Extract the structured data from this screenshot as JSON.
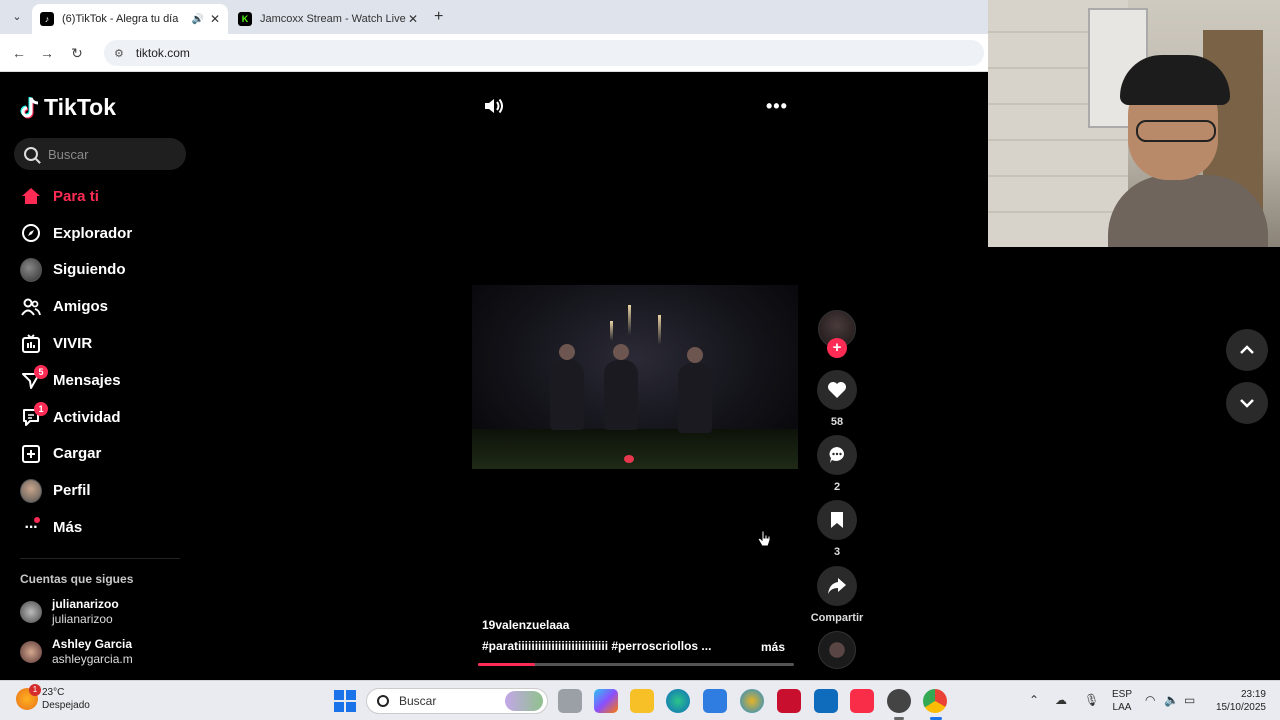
{
  "browser": {
    "tabs": [
      {
        "title": "(6)TikTok - Alegra tu día",
        "active": true,
        "favicon": "tiktok-favicon"
      },
      {
        "title": "Jamcoxx Stream - Watch Live on",
        "active": false,
        "favicon": "kick-favicon"
      }
    ],
    "url": "tiktok.com"
  },
  "sidebar": {
    "logo": "TikTok",
    "search_placeholder": "Buscar",
    "nav": [
      {
        "label": "Para ti",
        "icon": "home-icon",
        "active": true
      },
      {
        "label": "Explorador",
        "icon": "compass-icon"
      },
      {
        "label": "Siguiendo",
        "icon": "following-avatar"
      },
      {
        "label": "Amigos",
        "icon": "friends-icon"
      },
      {
        "label": "VIVIR",
        "icon": "live-icon"
      },
      {
        "label": "Mensajes",
        "icon": "messages-icon",
        "badge": "5"
      },
      {
        "label": "Actividad",
        "icon": "activity-icon",
        "badge": "1"
      },
      {
        "label": "Cargar",
        "icon": "upload-icon"
      },
      {
        "label": "Perfil",
        "icon": "profile-avatar"
      },
      {
        "label": "Más",
        "icon": "more-icon"
      }
    ],
    "following_title": "Cuentas que sigues",
    "following": [
      {
        "name": "julianarizoo",
        "handle": "julianarizoo"
      },
      {
        "name": "Ashley Garcia",
        "handle": "ashleygarcia.m"
      }
    ]
  },
  "video": {
    "username": "19valenzuelaaa",
    "hashtags": "#paratiiiiiiiiiiiiiiiiiiiiiiiiiii  #perroscriollos  ...",
    "more_label": "más",
    "progress": 0.18
  },
  "actions": {
    "likes": "58",
    "comments": "2",
    "saves": "3",
    "share_label": "Compartir"
  },
  "taskbar": {
    "weather_temp": "23°C",
    "weather_desc": "Despejado",
    "weather_badge": "1",
    "search_placeholder": "Buscar",
    "lang_line1": "ESP",
    "lang_line2": "LAA",
    "time": "23:19",
    "date": "15/10/2025"
  },
  "colors": {
    "accent": "#fe2c55",
    "background": "#000000"
  }
}
